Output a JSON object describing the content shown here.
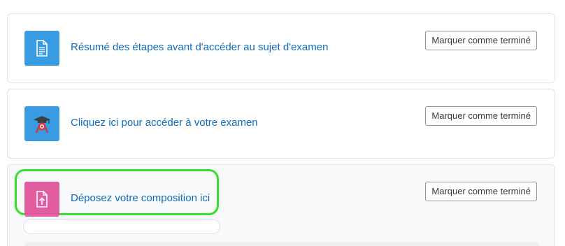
{
  "activities": [
    {
      "title": "Résumé des étapes avant d'accéder au sujet d'examen",
      "button_label": "Marquer comme terminé",
      "icon": "document-page-icon",
      "icon_color": "#399be2"
    },
    {
      "title": "Cliquez ici pour accéder à votre examen",
      "button_label": "Marquer comme terminé",
      "icon": "graduation-cap-exam-icon",
      "icon_color": "#399be2"
    },
    {
      "title": "Déposez votre composition ici",
      "button_label": "Marquer comme terminé",
      "icon": "file-upload-icon",
      "icon_color": "#e25d9f"
    }
  ],
  "colors": {
    "link": "#0f6cbf",
    "highlight": "#33e02a",
    "border": "#dee2e6"
  }
}
